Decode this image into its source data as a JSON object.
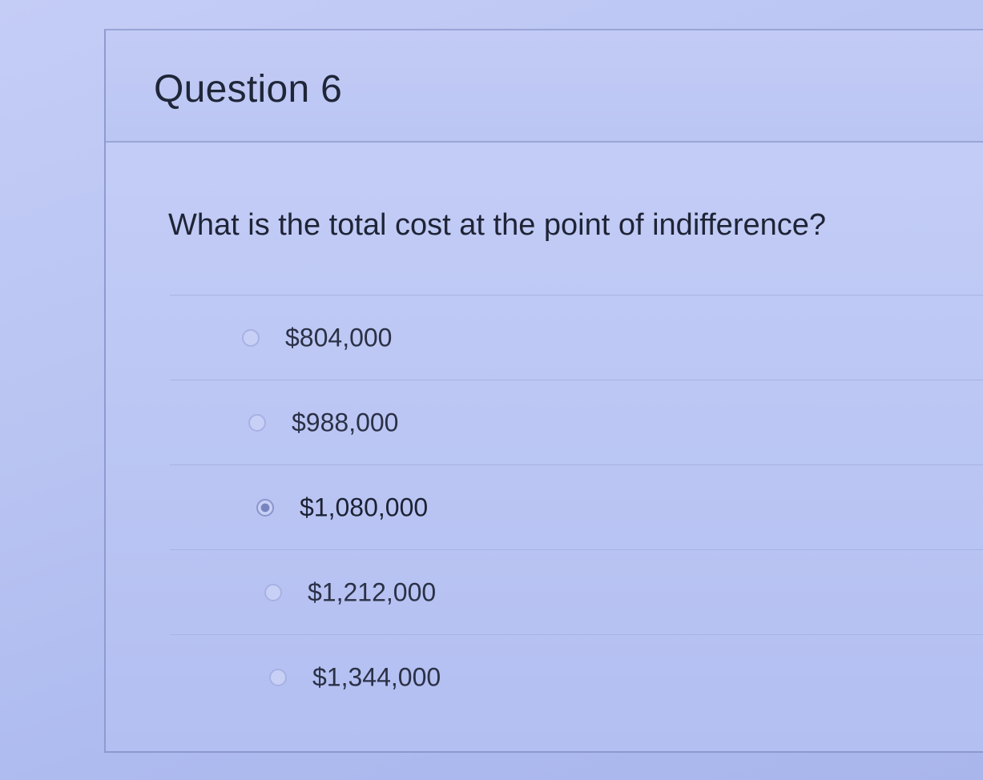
{
  "question": {
    "title": "Question 6",
    "text": "What is the total cost at the point of indifference?"
  },
  "answers": [
    {
      "label": "$804,000",
      "selected": false
    },
    {
      "label": "$988,000",
      "selected": false
    },
    {
      "label": "$1,080,000",
      "selected": true
    },
    {
      "label": "$1,212,000",
      "selected": false
    },
    {
      "label": "$1,344,000",
      "selected": false
    }
  ],
  "colors": {
    "background": "#b9c4f2",
    "text": "#1f2638",
    "border": "#9aa5d8",
    "radio_fill_checked": "#7884bd"
  }
}
